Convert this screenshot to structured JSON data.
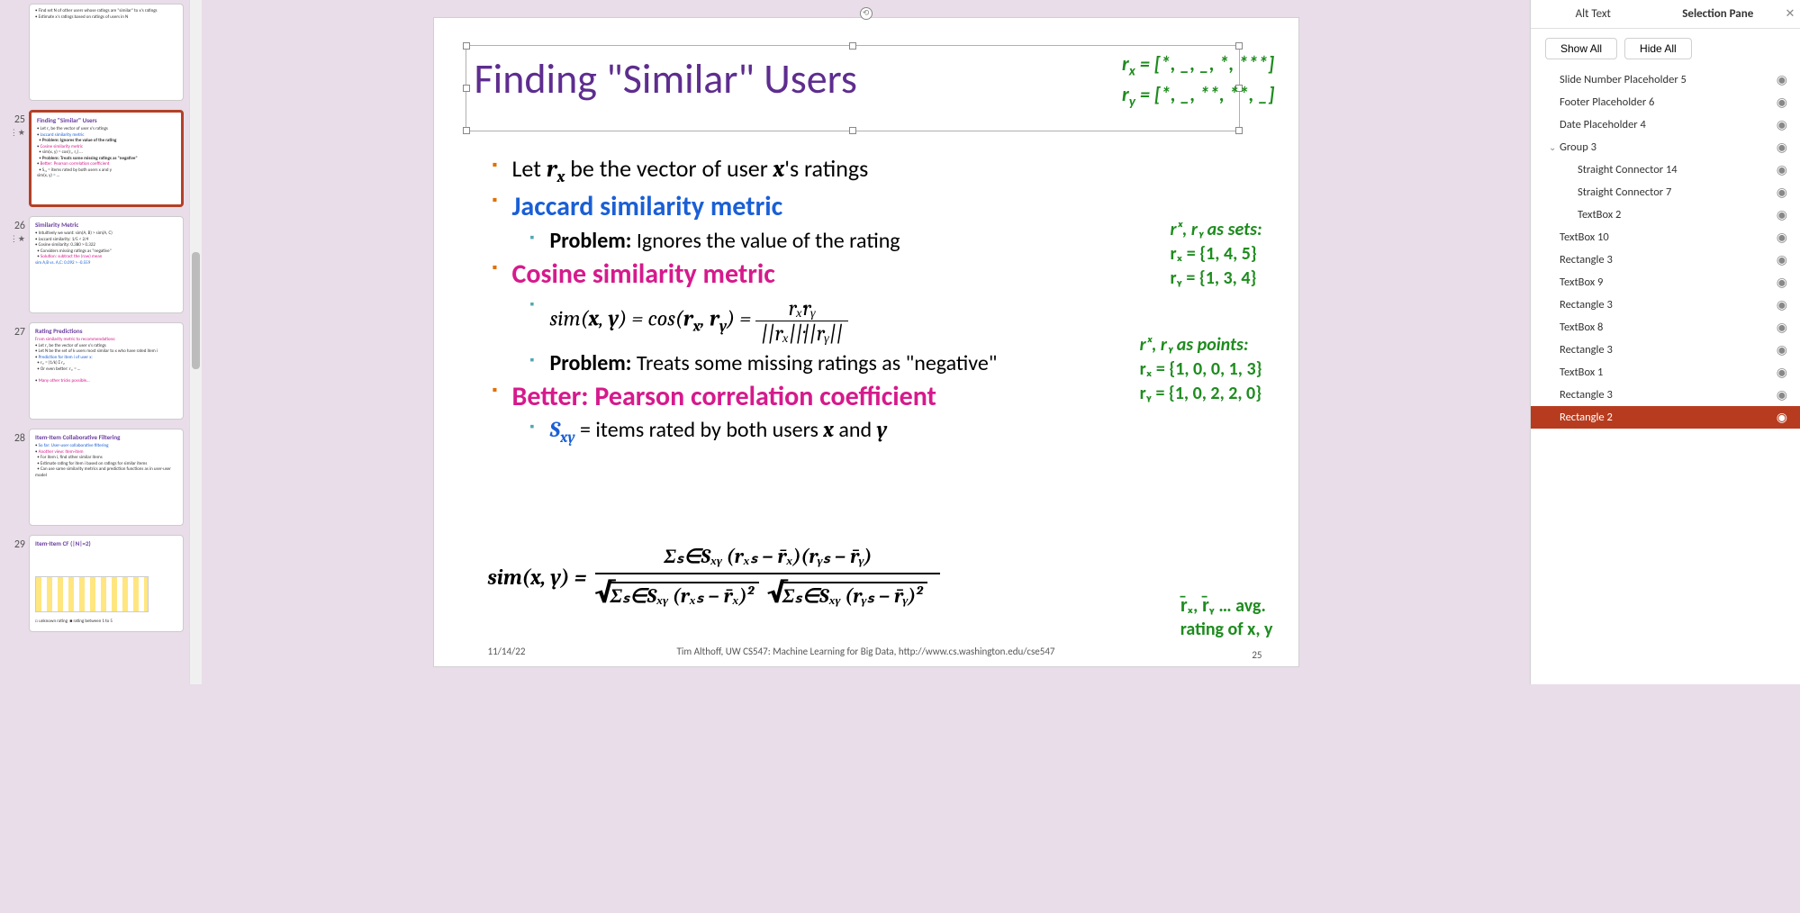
{
  "thumbnails": [
    {
      "num": "",
      "title": "",
      "body_lines": [
        "Find set N of other users whose ratings are \"similar\" to x's ratings",
        "Estimate x's ratings based on ratings of users in N"
      ]
    },
    {
      "num": "25",
      "starred": true,
      "selected": true,
      "title": "Finding \"Similar\" Users",
      "body_lines": [
        "Let rₓ be the vector of user x's ratings",
        "Jaccard similarity metric",
        "Problem: Ignores the value of the rating",
        "Cosine similarity metric",
        "sim(x, y) = cos(rₓ, rᵧ) …",
        "Problem: Treats some missing ratings as \"negative\"",
        "Better: Pearson correlation coefficient",
        "Sₓᵧ = items rated by both users x and y",
        "sim(x, y) = …"
      ]
    },
    {
      "num": "26",
      "starred": true,
      "title": "Similarity Metric",
      "body_lines": [
        "Intuitively we want: sim(A, B) > sim(A, C)",
        "Jaccard similarity: 1/5 < 2/4",
        "Cosine similarity: 0.380 > 0.322",
        "Considers missing ratings as \"negative\"",
        "Solution: subtract the (row) mean",
        "sim A,B vs. A,C: 0.092 > -0.559"
      ]
    },
    {
      "num": "27",
      "title": "Rating Predictions",
      "body_lines": [
        "From similarity metric to recommendations:",
        "Let rₓ be the vector of user x's ratings",
        "Let N be the set of k users most similar to x who have rated item i",
        "Prediction for item i of user x:",
        "rₓᵢ = (1/k) Σ rᵧᵢ",
        "Or even better: rₓᵢ = …",
        "Many other tricks possible…"
      ]
    },
    {
      "num": "28",
      "title": "Item-Item Collaborative Filtering",
      "body_lines": [
        "So far: User-user collaborative filtering",
        "Another view: Item-item",
        "For item i, find other similar items",
        "Estimate rating for item i based on ratings for similar items",
        "Can use same similarity metrics and prediction functions as in user-user model"
      ]
    },
    {
      "num": "29",
      "title": "Item-Item CF (|N|=2)",
      "body_lines": [
        "unknown rating",
        "rating between 1 to 5"
      ]
    }
  ],
  "slide": {
    "title": "Finding \"Similar\" Users",
    "vec_annot": {
      "l1_pre": "r",
      "l1_sub": "x",
      "l1_post": " = [*, _, _, *, ***]",
      "l2_pre": "r",
      "l2_sub": "y",
      "l2_post": " = [*, _, **, **, _]"
    },
    "bullet1_pre": "Let ",
    "bullet1_rx": "r",
    "bullet1_rxsub": "x",
    "bullet1_mid": " be the vector of user ",
    "bullet1_x": "x",
    "bullet1_post": "'s ratings",
    "jaccard": "Jaccard similarity metric",
    "jaccard_sub_bold": "Problem:",
    "jaccard_sub_rest": " Ignores the value of the rating",
    "cosine": "Cosine similarity metric",
    "cos_formula_pre": "sim(",
    "cos_formula_x": "x",
    "cos_formula_c1": ", ",
    "cos_formula_y": "y",
    "cos_formula_mid": ") = cos(",
    "cos_rx": "r",
    "cos_rx_s": "x",
    "cos_c2": ", ",
    "cos_ry": "r",
    "cos_ry_s": "y",
    "cos_close": ") = ",
    "cos_num": "rₓ·rᵧ",
    "cos_den": "||rₓ||·||rᵧ||",
    "cos_sub_bold": "Problem:",
    "cos_sub_rest": " Treats some missing ratings as \"negative\"",
    "pearson": "Better: Pearson correlation coefficient",
    "sxy_pre": "S",
    "sxy_sub": "xy",
    "sxy_post": " = items rated by both users ",
    "sxy_x": "x",
    "sxy_and": " and ",
    "sxy_y": "y",
    "sim_lhs": "sim(x, y)  =",
    "big_num": "Σₛ∈Sₓᵧ (rₓₛ − r̄ₓ)(rᵧₛ − r̄ᵧ)",
    "big_den1": "Σₛ∈Sₓᵧ (rₓₛ − r̄ₓ)²",
    "big_den2": "Σₛ∈Sₓᵧ (rᵧₛ − r̄ᵧ)²",
    "sets_title": "rₓ, rᵧ as sets:",
    "sets_l1": "rₓ = {1, 4, 5}",
    "sets_l2": "rᵧ = {1, 3, 4}",
    "pts_title": "rₓ, rᵧ as points:",
    "pts_l1": "rₓ = {1, 0, 0, 1, 3}",
    "pts_l2": "rᵧ = {1, 0, 2, 2, 0}",
    "avg_l1": "r̄ₓ, r̄ᵧ … avg.",
    "avg_l2": "rating of x, y",
    "footer_date": "11/14/22",
    "footer_center": "Tim Althoff, UW CS547: Machine Learning for Big Data, http://www.cs.washington.edu/cse547",
    "footer_num": "25"
  },
  "right": {
    "tab1": "Alt Text",
    "tab2": "Selection Pane",
    "show_all": "Show All",
    "hide_all": "Hide All",
    "items": [
      {
        "label": "Slide Number Placeholder 5",
        "indent": 0
      },
      {
        "label": "Footer Placeholder 6",
        "indent": 0
      },
      {
        "label": "Date Placeholder 4",
        "indent": 0
      },
      {
        "label": "Group 3",
        "indent": 0,
        "expand": true
      },
      {
        "label": "Straight Connector 14",
        "indent": 1
      },
      {
        "label": "Straight Connector 7",
        "indent": 1
      },
      {
        "label": "TextBox 2",
        "indent": 1
      },
      {
        "label": "TextBox 10",
        "indent": 0
      },
      {
        "label": "Rectangle 3",
        "indent": 0
      },
      {
        "label": "TextBox 9",
        "indent": 0
      },
      {
        "label": "Rectangle 3",
        "indent": 0
      },
      {
        "label": "TextBox 8",
        "indent": 0
      },
      {
        "label": "Rectangle 3",
        "indent": 0
      },
      {
        "label": "TextBox 1",
        "indent": 0
      },
      {
        "label": "Rectangle 3",
        "indent": 0
      },
      {
        "label": "Rectangle 2",
        "indent": 0,
        "selected": true
      }
    ]
  }
}
